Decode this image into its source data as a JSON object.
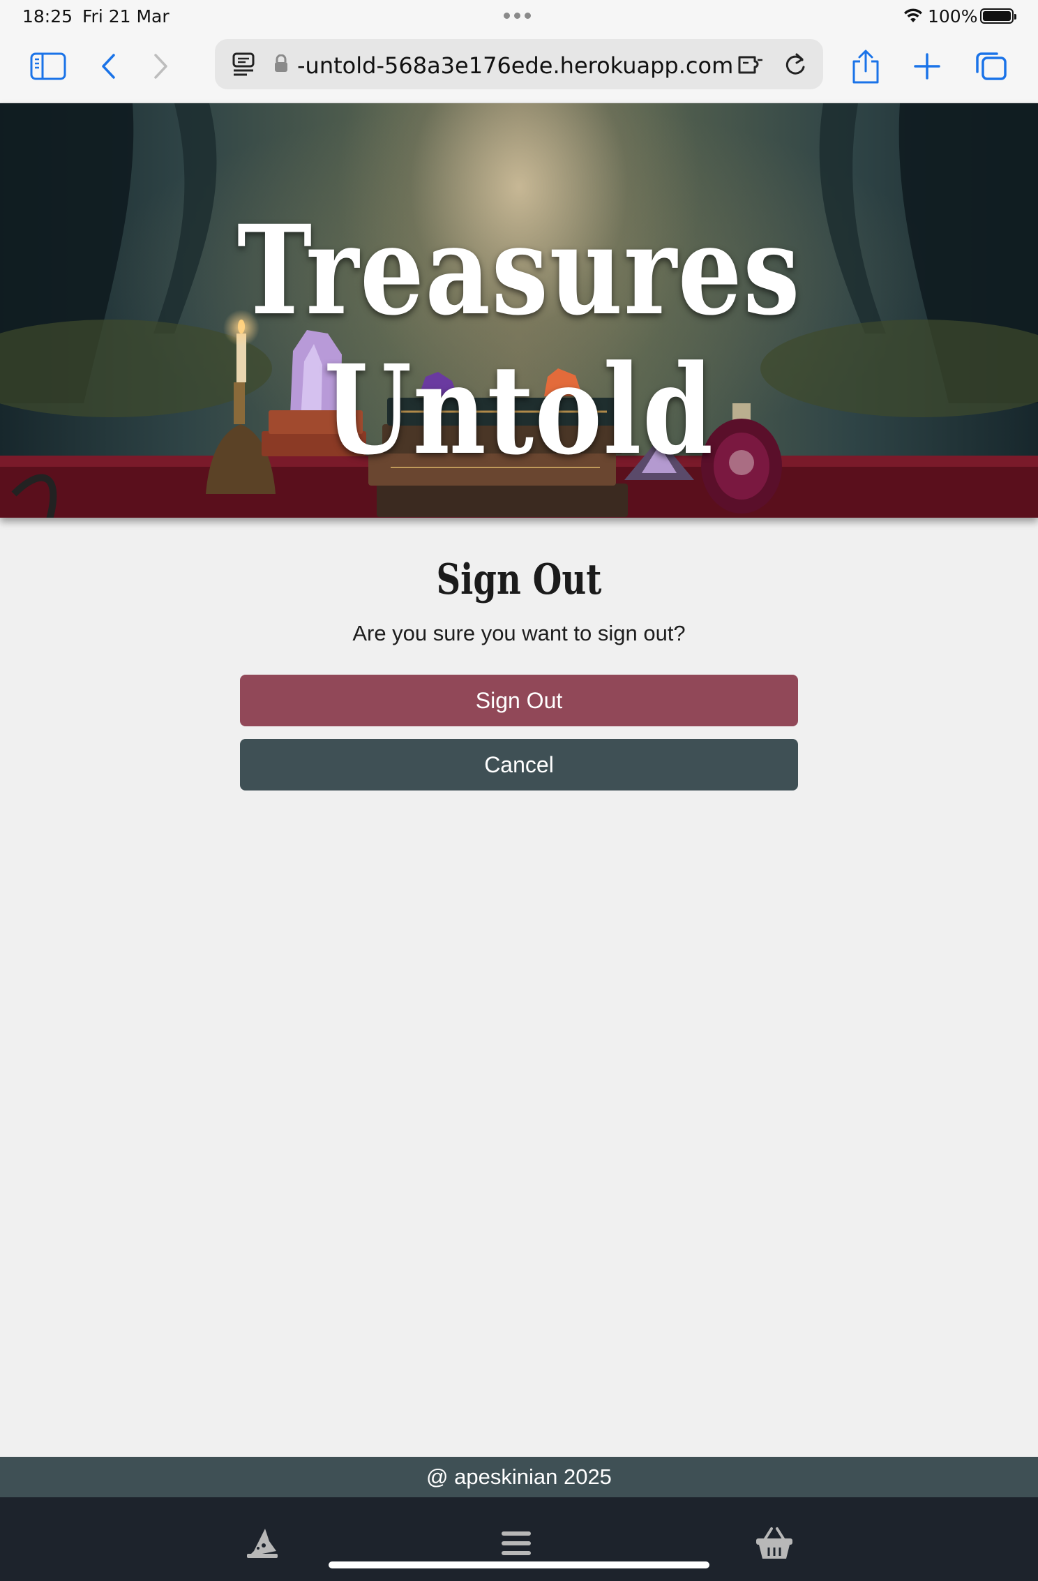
{
  "status_bar": {
    "time": "18:25",
    "date": "Fri 21 Mar",
    "battery": "100%"
  },
  "browser": {
    "url": "-untold-568a3e176ede.herokuapp.com",
    "icons": [
      "sidebar-icon",
      "back-icon",
      "forward-icon",
      "reader-icon",
      "lock-icon",
      "extension-icon",
      "reload-icon",
      "share-icon",
      "plus-icon",
      "tabs-icon"
    ]
  },
  "hero": {
    "title": "Treasures Untold"
  },
  "main": {
    "title": "Sign Out",
    "message": "Are you sure you want to sign out?",
    "signout_label": "Sign Out",
    "cancel_label": "Cancel"
  },
  "footer": {
    "text": "@ apeskinian 2025"
  },
  "bottom_nav": {
    "icons": [
      "wizard-hat-icon",
      "menu-icon",
      "basket-icon"
    ]
  },
  "colors": {
    "signout_button": "#914858",
    "cancel_button": "#3f5055",
    "footer": "#3f5055",
    "bottom_nav": "#1d232c",
    "page_background": "#f0f0f0",
    "safari_accent": "#1a73e8"
  }
}
